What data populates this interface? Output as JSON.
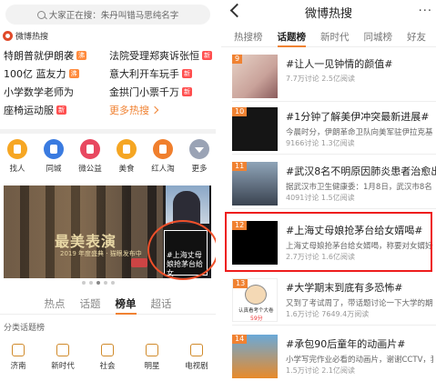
{
  "left": {
    "search_text": "大家正在搜：朱丹叫错马思纯名字",
    "hot_header": "微博热搜",
    "hot_items": [
      {
        "text": "特朗普就伊朗袭",
        "tag": "沸"
      },
      {
        "text": "法院受理郑爽诉张恒",
        "tag": "新"
      },
      {
        "text": "100亿 蓝友力",
        "tag": "沸"
      },
      {
        "text": "意大利开车玩手",
        "tag": "新"
      },
      {
        "text": "小学数学老师为",
        "tag": ""
      },
      {
        "text": "金拱门小票千万",
        "tag": "新"
      },
      {
        "text": "座椅运动服",
        "tag": "新"
      },
      {
        "text": "更多热搜",
        "tag": ""
      }
    ],
    "icons": [
      {
        "label": "找人",
        "icon": "person-icon"
      },
      {
        "label": "同城",
        "icon": "building-icon"
      },
      {
        "label": "微公益",
        "icon": "heart-icon"
      },
      {
        "label": "美食",
        "icon": "food-icon"
      },
      {
        "label": "红人淘",
        "icon": "bag-icon"
      },
      {
        "label": "更多",
        "icon": "chevron-down-icon"
      }
    ],
    "banner": {
      "title": "最美表演",
      "subtitle": "2019 年度盛典 · 猫眼发布中",
      "thumb_caption": "#上海丈母娘抢茅台给女婿喝#",
      "card_text": "#上海丈母娘抢茅台给女"
    },
    "tabs": [
      "热点",
      "话题",
      "榜单",
      "超话"
    ],
    "active_tab": "榜单",
    "category_title": "分类话题榜",
    "categories": [
      "济南",
      "新时代",
      "社会",
      "明星",
      "电视剧"
    ]
  },
  "right": {
    "title": "微博热搜",
    "tabs": [
      "热搜榜",
      "话题榜",
      "新时代",
      "同城榜",
      "好友"
    ],
    "active_tab": "话题榜",
    "items": [
      {
        "rank": "9",
        "title": "#让人一见钟情的颜值#",
        "desc": "",
        "stat": "7.7万讨论 2.5亿阅读"
      },
      {
        "rank": "10",
        "title": "#1分钟了解美伊冲突最新进展#",
        "desc": "今晨时分，伊朗革命卫队向美军驻伊拉克基地",
        "stat": "9166讨论 1.3亿阅读"
      },
      {
        "rank": "11",
        "title": "#武汉8名不明原因肺炎患者治愈出院#",
        "desc": "据武汉市卫生健康委：1月8日，武汉市8名",
        "stat": "4091讨论 1.5亿阅读"
      },
      {
        "rank": "12",
        "title": "#上海丈母娘抢茅台给女婿喝#",
        "desc": "上海丈母娘抢茅台给女婿喝，称要对女婿好一点",
        "stat": "2.7万讨论 1.6亿阅读"
      },
      {
        "rank": "13",
        "title": "#大学期末到底有多恐怖#",
        "desc": "又到了考试周了，带话题讨论一下大学的期末考试",
        "stat": "1.6万讨论 7649.4万阅读"
      },
      {
        "rank": "14",
        "title": "#承包90后童年的动画片#",
        "desc": "小学写完作业必看的动画片，谢谢CCTV，我最",
        "stat": "1.5万讨论 2.1亿阅读"
      }
    ],
    "meme_caption": "认真看考个大卷",
    "meme_score": "59分"
  }
}
